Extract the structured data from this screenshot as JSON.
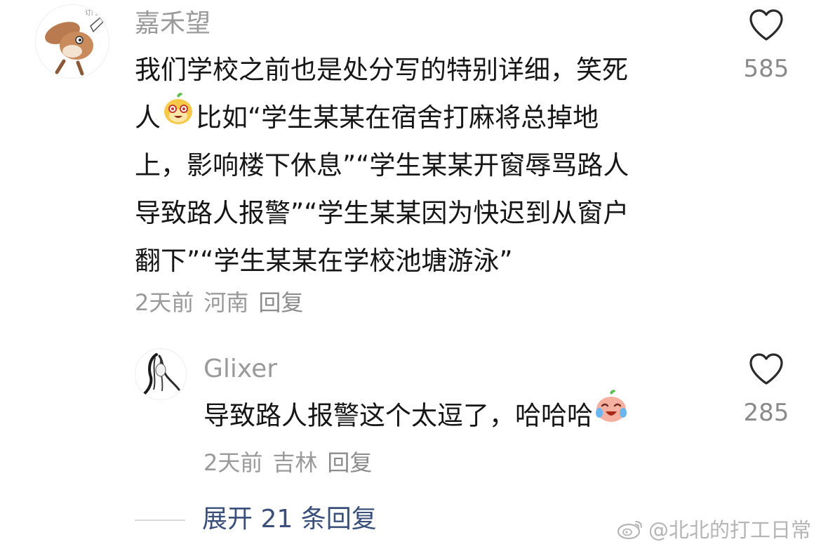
{
  "comments": [
    {
      "username": "嘉禾望",
      "lines": [
        "我们学校之前也是处分写的特别详细，笑死",
        "人",
        "比如“学生某某在宿舍打麻将总掉地",
        "上，影响楼下休息”“学生某某开窗辱骂路人",
        "导致路人报警”“学生某某因为快迟到从窗户",
        "翻下”“学生某某在学校池塘游泳”"
      ],
      "time": "2天前",
      "location": "河南",
      "reply_label": "回复",
      "likes": "585",
      "avatar_icon": "cartoon-squirrel-avatar",
      "emoji_icon": "laughing-face-emoji"
    },
    {
      "username": "Glixer",
      "text": "导致路人报警这个太逗了，哈哈哈",
      "time": "2天前",
      "location": "吉林",
      "reply_label": "回复",
      "likes": "285",
      "avatar_icon": "ink-sketch-avatar",
      "emoji_icon": "crying-laughing-emoji"
    }
  ],
  "expand_label": "展开 21 条回复",
  "watermark": "@北北的打工日常",
  "colors": {
    "username": "#9a9a9a",
    "text": "#161616",
    "meta": "#9a9a9a",
    "link": "#3a4f7a",
    "like_count": "#8a8a8a"
  }
}
